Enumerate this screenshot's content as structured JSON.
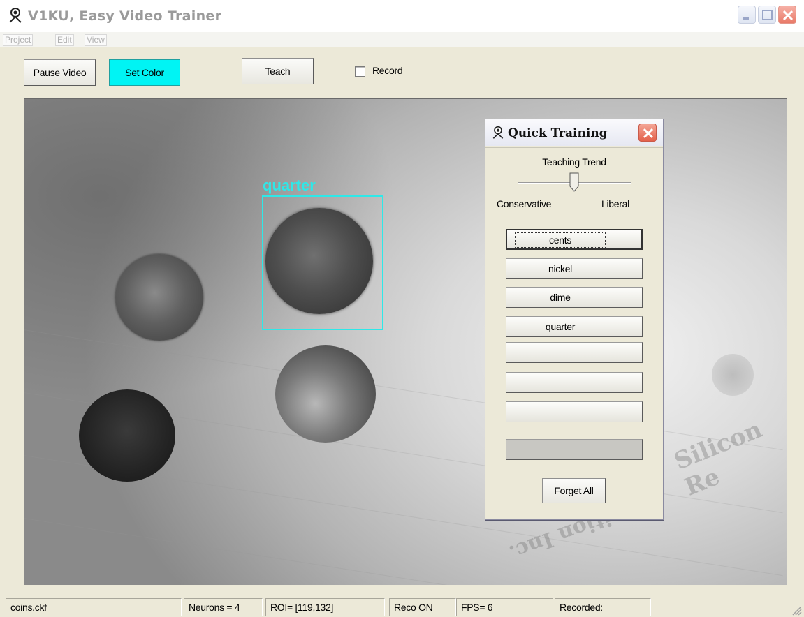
{
  "window": {
    "title": "V1KU, Easy Video Trainer"
  },
  "menu": {
    "items": [
      "Project",
      "Edit",
      "View"
    ]
  },
  "toolbar": {
    "pause_label": "Pause Video",
    "set_color_label": "Set Color",
    "set_color_bg": "#00f4f4",
    "teach_label": "Teach",
    "record_label": "Record",
    "record_checked": false
  },
  "video": {
    "roi_label": "quarter",
    "roi_color": "#2ee8e8",
    "watermark_1": "Silicon Re",
    "watermark_2": "gnition Inc."
  },
  "quick_training": {
    "title": "Quick Training",
    "teaching_trend_label": "Teaching Trend",
    "slider_left_label": "Conservative",
    "slider_right_label": "Liberal",
    "slider_value": 0.5,
    "categories": [
      "cents",
      "nickel",
      "dime",
      "quarter",
      "",
      "",
      ""
    ],
    "forget_label": "Forget All"
  },
  "status": {
    "file": "coins.ckf",
    "neurons": "Neurons = 4",
    "roi": "ROI= [119,132]",
    "reco": "Reco ON",
    "fps": "FPS= 6",
    "recorded": "Recorded:"
  }
}
